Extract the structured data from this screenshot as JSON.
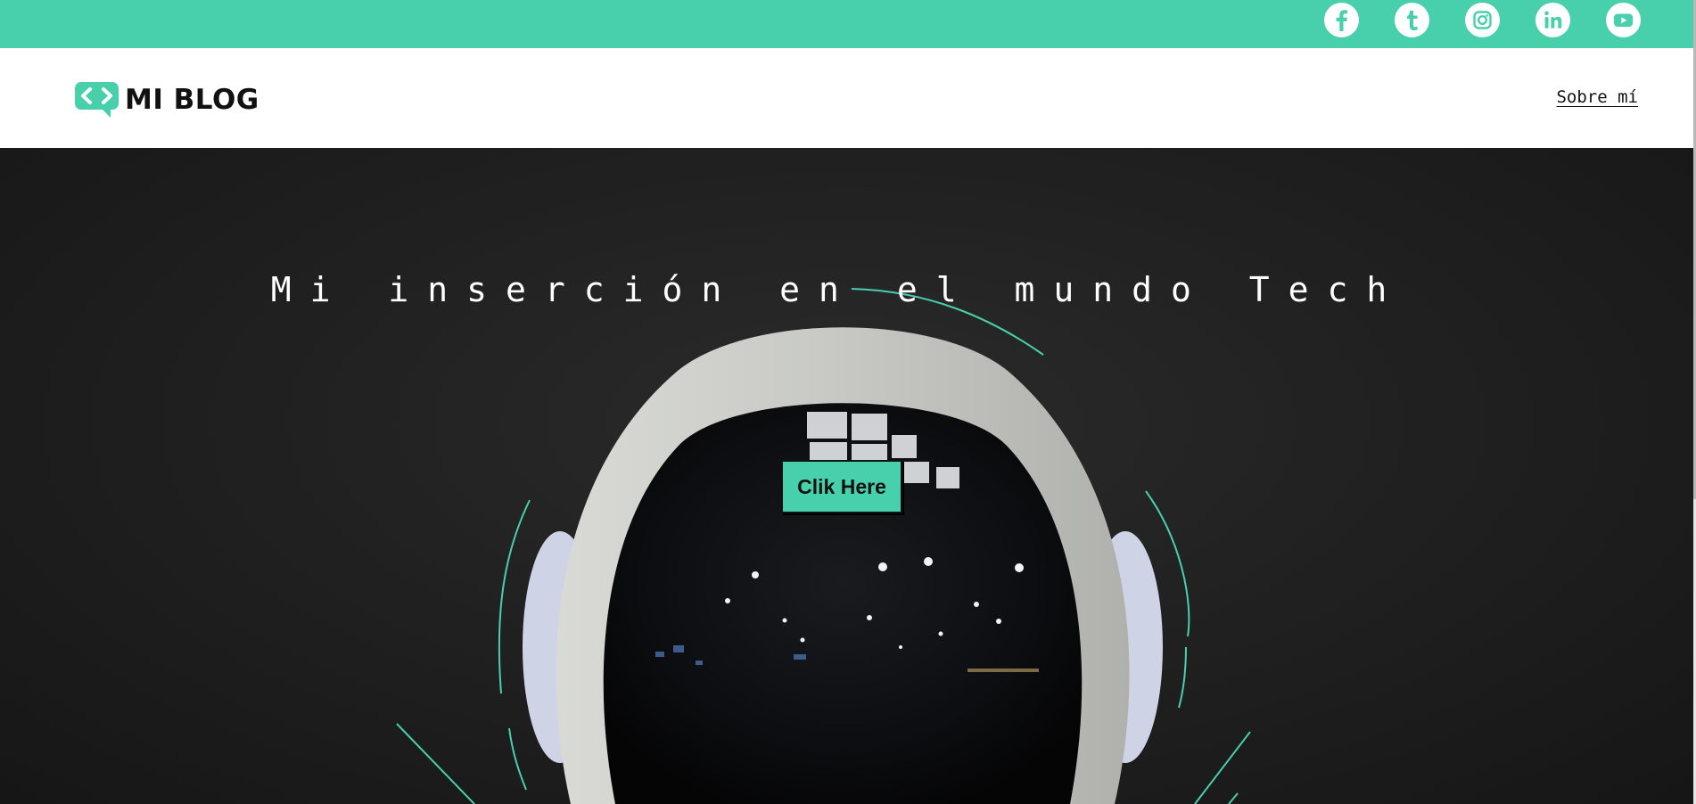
{
  "brand": {
    "name": "MI BLOG",
    "accent": "#48d0ad"
  },
  "topbar": {
    "social": [
      {
        "icon": "facebook-icon"
      },
      {
        "icon": "tumblr-icon"
      },
      {
        "icon": "instagram-icon"
      },
      {
        "icon": "linkedin-icon"
      },
      {
        "icon": "youtube-icon"
      }
    ]
  },
  "nav": {
    "about_label": "Sobre mí"
  },
  "hero": {
    "title": "Mi inserción en el mundo Tech",
    "cta_label": "Clik Here"
  }
}
